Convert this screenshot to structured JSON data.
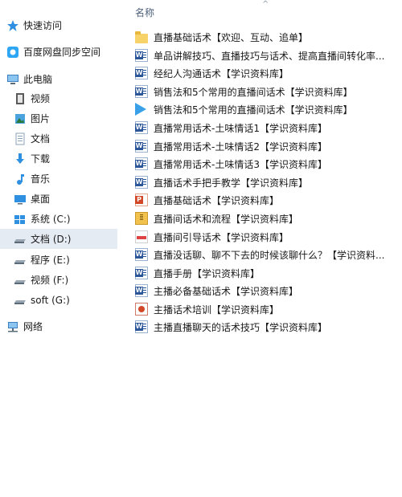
{
  "sidebar": {
    "items": [
      {
        "label": "快速访问",
        "icon": "star-icon"
      },
      {
        "label": "百度网盘同步空间",
        "icon": "baidu-netdisk-icon"
      },
      {
        "label": "此电脑",
        "icon": "computer-icon"
      },
      {
        "label": "视频",
        "icon": "video-folder-icon"
      },
      {
        "label": "图片",
        "icon": "picture-folder-icon"
      },
      {
        "label": "文档",
        "icon": "document-folder-icon"
      },
      {
        "label": "下载",
        "icon": "download-folder-icon"
      },
      {
        "label": "音乐",
        "icon": "music-folder-icon"
      },
      {
        "label": "桌面",
        "icon": "desktop-folder-icon"
      },
      {
        "label": "系统 (C:)",
        "icon": "windows-drive-icon"
      },
      {
        "label": "文档 (D:)",
        "icon": "drive-icon",
        "selected": true
      },
      {
        "label": "程序 (E:)",
        "icon": "drive-icon"
      },
      {
        "label": "视频 (F:)",
        "icon": "drive-icon"
      },
      {
        "label": "soft (G:)",
        "icon": "drive-icon"
      },
      {
        "label": "网络",
        "icon": "network-icon"
      }
    ]
  },
  "main": {
    "column_header": "名称",
    "sort_indicator": "^",
    "files": [
      {
        "name": "直播基础话术【欢迎、互动、追单】",
        "type": "folder"
      },
      {
        "name": "单品讲解技巧、直播技巧与话术、提高直播间转化率...",
        "type": "word"
      },
      {
        "name": "经纪人沟通话术【学识资料库】",
        "type": "word"
      },
      {
        "name": "销售法和5个常用的直播间话术【学识资料库】",
        "type": "word"
      },
      {
        "name": "销售法和5个常用的直播间话术【学识资料库】",
        "type": "video"
      },
      {
        "name": "直播常用话术-土味情话1【学识资料库】",
        "type": "word"
      },
      {
        "name": "直播常用话术-土味情话2【学识资料库】",
        "type": "word"
      },
      {
        "name": "直播常用话术-土味情话3【学识资料库】",
        "type": "word"
      },
      {
        "name": "直播话术手把手教学【学识资料库】",
        "type": "word"
      },
      {
        "name": "直播基础话术【学识资料库】",
        "type": "ppt"
      },
      {
        "name": "直播间话术和流程【学识资料库】",
        "type": "zip"
      },
      {
        "name": "直播间引导话术【学识资料库】",
        "type": "pdf"
      },
      {
        "name": "直播没话聊、聊不下去的时候该聊什么？【学识资料...",
        "type": "word"
      },
      {
        "name": "直播手册【学识资料库】",
        "type": "word"
      },
      {
        "name": "主播必备基础话术【学识资料库】",
        "type": "word"
      },
      {
        "name": "主播话术培训【学识资料库】",
        "type": "pptgen"
      },
      {
        "name": "主播直播聊天的话术技巧【学识资料库】",
        "type": "word"
      }
    ]
  },
  "colors": {
    "selected_bg": "#e5ebf2",
    "header_text": "#4c607a",
    "accent": "#2b579a"
  }
}
